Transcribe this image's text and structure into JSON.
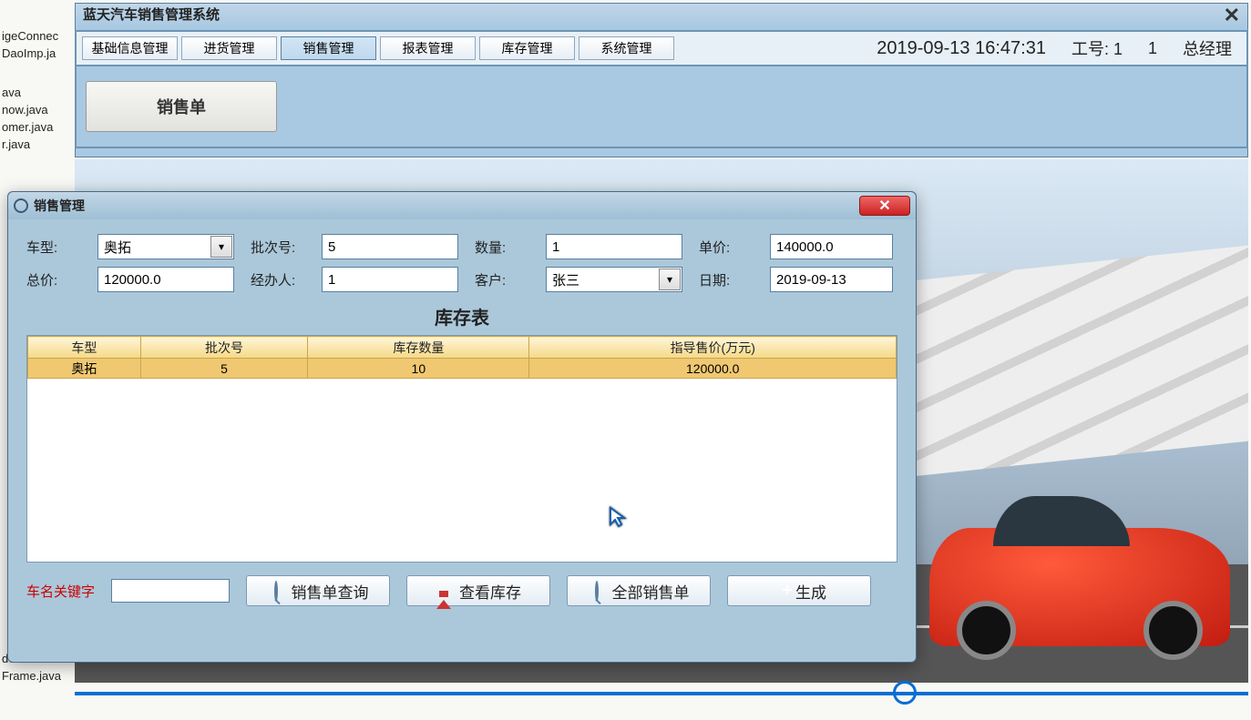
{
  "desktop_files": [
    "igeConnec",
    "DaoImp.ja",
    "ava",
    "now.java",
    "omer.java",
    "r.java",
    "deFrame.i",
    "Frame.java"
  ],
  "main_window": {
    "title": "蓝天汽车销售管理系统",
    "tabs": [
      "基础信息管理",
      "进货管理",
      "销售管理",
      "报表管理",
      "库存管理",
      "系统管理"
    ],
    "active_tab_index": 2,
    "datetime": "2019-09-13 16:47:31",
    "emp_label": "工号: 1",
    "emp_extra": "1",
    "role": "总经理",
    "sub_button": "销售单"
  },
  "dialog": {
    "title": "销售管理",
    "form": {
      "labels": {
        "model": "车型:",
        "batch": "批次号:",
        "qty": "数量:",
        "price": "单价:",
        "total": "总价:",
        "handler": "经办人:",
        "customer": "客户:",
        "date": "日期:"
      },
      "model_value": "奥拓",
      "batch_value": "5",
      "qty_value": "1",
      "price_value": "140000.0",
      "total_value": "120000.0",
      "handler_value": "1",
      "customer_value": "张三",
      "date_value": "2019-09-13"
    },
    "table_title": "库存表",
    "table_headers": [
      "车型",
      "批次号",
      "库存数量",
      "指导售价(万元)"
    ],
    "table_rows": [
      {
        "model": "奥拓",
        "batch": "5",
        "qty": "10",
        "price": "120000.0"
      }
    ],
    "keyword_label": "车名关键字",
    "keyword_value": "",
    "buttons": {
      "query": "销售单查询",
      "view_stock": "查看库存",
      "all_orders": "全部销售单",
      "generate": "生成"
    }
  }
}
